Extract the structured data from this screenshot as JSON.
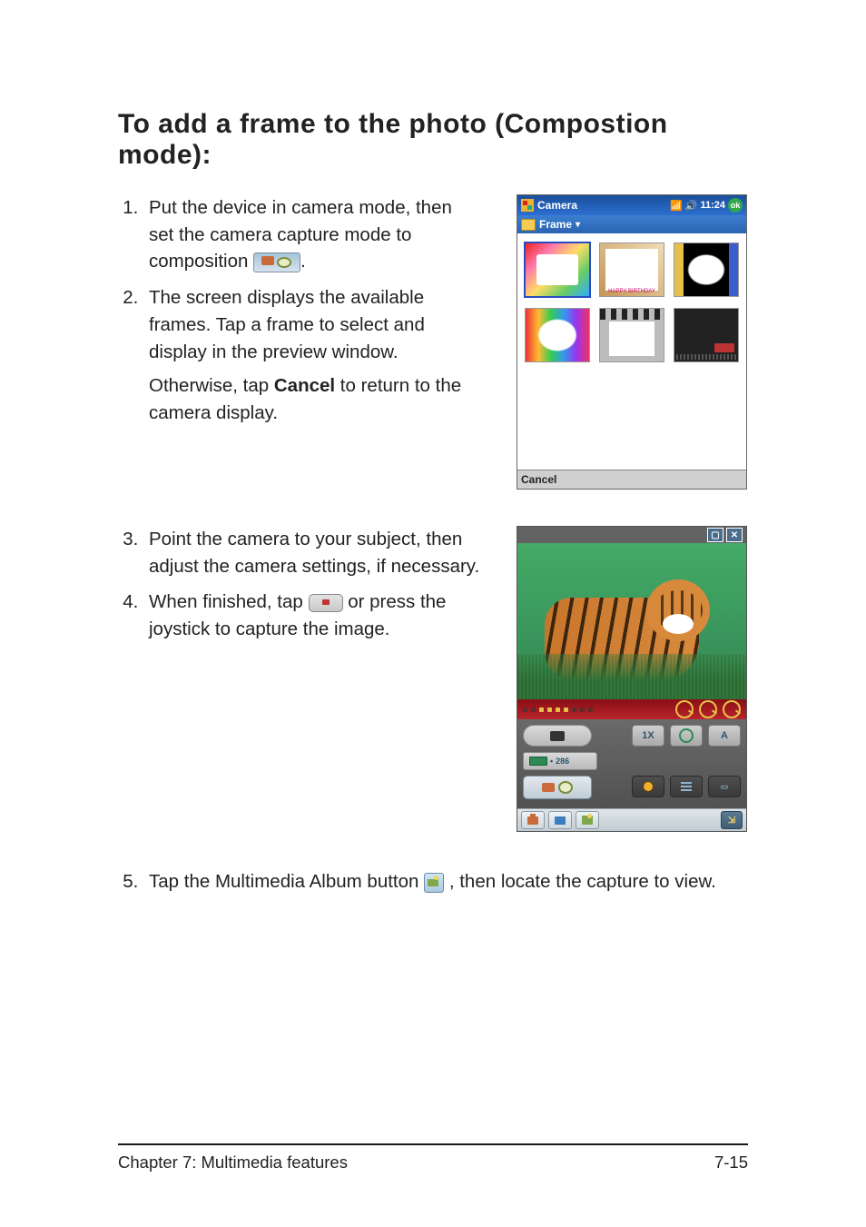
{
  "section_title": "To add a frame to the photo (Compostion mode):",
  "steps_block1": {
    "s1_a": "Put the device in camera mode, then set the camera capture mode to composition ",
    "s1_b": ".",
    "s2": "The screen displays the available frames. Tap a frame to select and display in the preview window.",
    "s2_note_a": "Otherwise, tap ",
    "s2_note_bold": "Cancel",
    "s2_note_b": " to return to the camera display."
  },
  "steps_block2": {
    "s3": "Point the camera to your subject, then adjust the camera settings, if necessary.",
    "s4_a": "When finished, tap ",
    "s4_b": " or press the joystick to capture the image."
  },
  "step5": {
    "a": "Tap the Multimedia Album button ",
    "b": ", then locate the capture to view."
  },
  "device1": {
    "title": "Camera",
    "time": "11:24",
    "ok": "ok",
    "toolbar_label": "Frame",
    "toolbar_drop": "▾",
    "frame2_caption": "HAPPY BIRTHDAY",
    "cancel": "Cancel"
  },
  "device2": {
    "win_min": "▢",
    "win_close": "✕",
    "zoom": "1X",
    "auto": "A",
    "remaining": "286",
    "sun_label": "☼",
    "exit": "⇲"
  },
  "footer": {
    "left": "Chapter 7: Multimedia features",
    "right": "7-15"
  }
}
